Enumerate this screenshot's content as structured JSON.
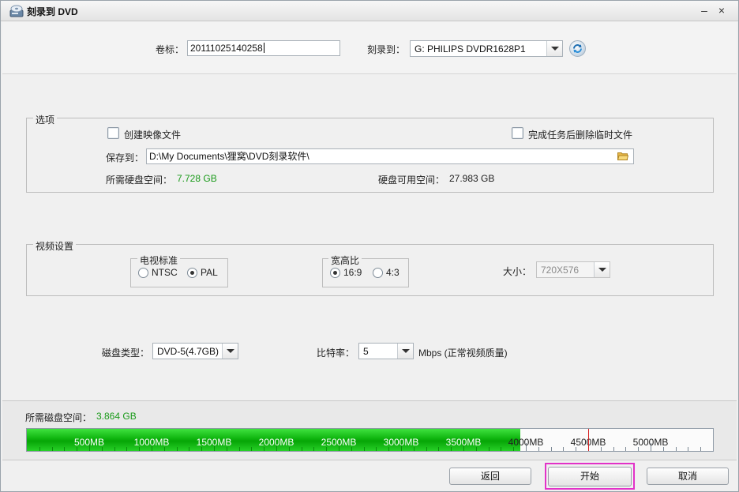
{
  "window": {
    "title": "刻录到 DVD",
    "minimize_glyph": "–",
    "close_glyph": "×"
  },
  "top": {
    "volume_label": "卷标：",
    "volume_value": "20111025140258",
    "burn_to_label": "刻录到：",
    "burn_to_value": "G: PHILIPS  DVDR1628P1"
  },
  "options": {
    "group_title": "选项",
    "create_image_label": "创建映像文件",
    "create_image_checked": false,
    "delete_temp_label": "完成任务后删除临时文件",
    "delete_temp_checked": false,
    "save_to_label": "保存到：",
    "save_to_path": "D:\\My Documents\\狸窝\\DVD刻录软件\\",
    "required_disk_label": "所需硬盘空间：",
    "required_disk_value": "7.728 GB",
    "available_disk_label": "硬盘可用空间：",
    "available_disk_value": "27.983 GB"
  },
  "video": {
    "group_title": "视频设置",
    "tv_standard_title": "电视标准",
    "tv_options": [
      "NTSC",
      "PAL"
    ],
    "tv_selected": "PAL",
    "aspect_title": "宽高比",
    "aspect_options": [
      "16:9",
      "4:3"
    ],
    "aspect_selected": "16:9",
    "size_label": "大小：",
    "size_value": "720X576"
  },
  "disc": {
    "type_label": "磁盘类型：",
    "type_value": "DVD-5(4.7GB)",
    "bitrate_label": "比特率：",
    "bitrate_value": "5",
    "bitrate_unit": "Mbps (正常视频质量)"
  },
  "usage": {
    "required_label": "所需磁盘空间：",
    "required_value": "3.864 GB",
    "used_mb": 3957,
    "capacity_marker_mb": 4500,
    "scale_max_mb": 5500,
    "tick_labels": [
      "500MB",
      "1000MB",
      "1500MB",
      "2000MB",
      "2500MB",
      "3000MB",
      "3500MB",
      "4000MB",
      "4500MB",
      "5000MB"
    ]
  },
  "buttons": {
    "back": "返回",
    "start": "开始",
    "cancel": "取消"
  },
  "colors": {
    "progress_green": "#0eb40e",
    "value_green": "#1a9a1a",
    "focus_magenta": "#e232c8",
    "capacity_red": "#d62020"
  },
  "icons": {
    "app": "dvd-burner-icon",
    "refresh": "refresh-icon",
    "folder": "folder-open-icon"
  }
}
